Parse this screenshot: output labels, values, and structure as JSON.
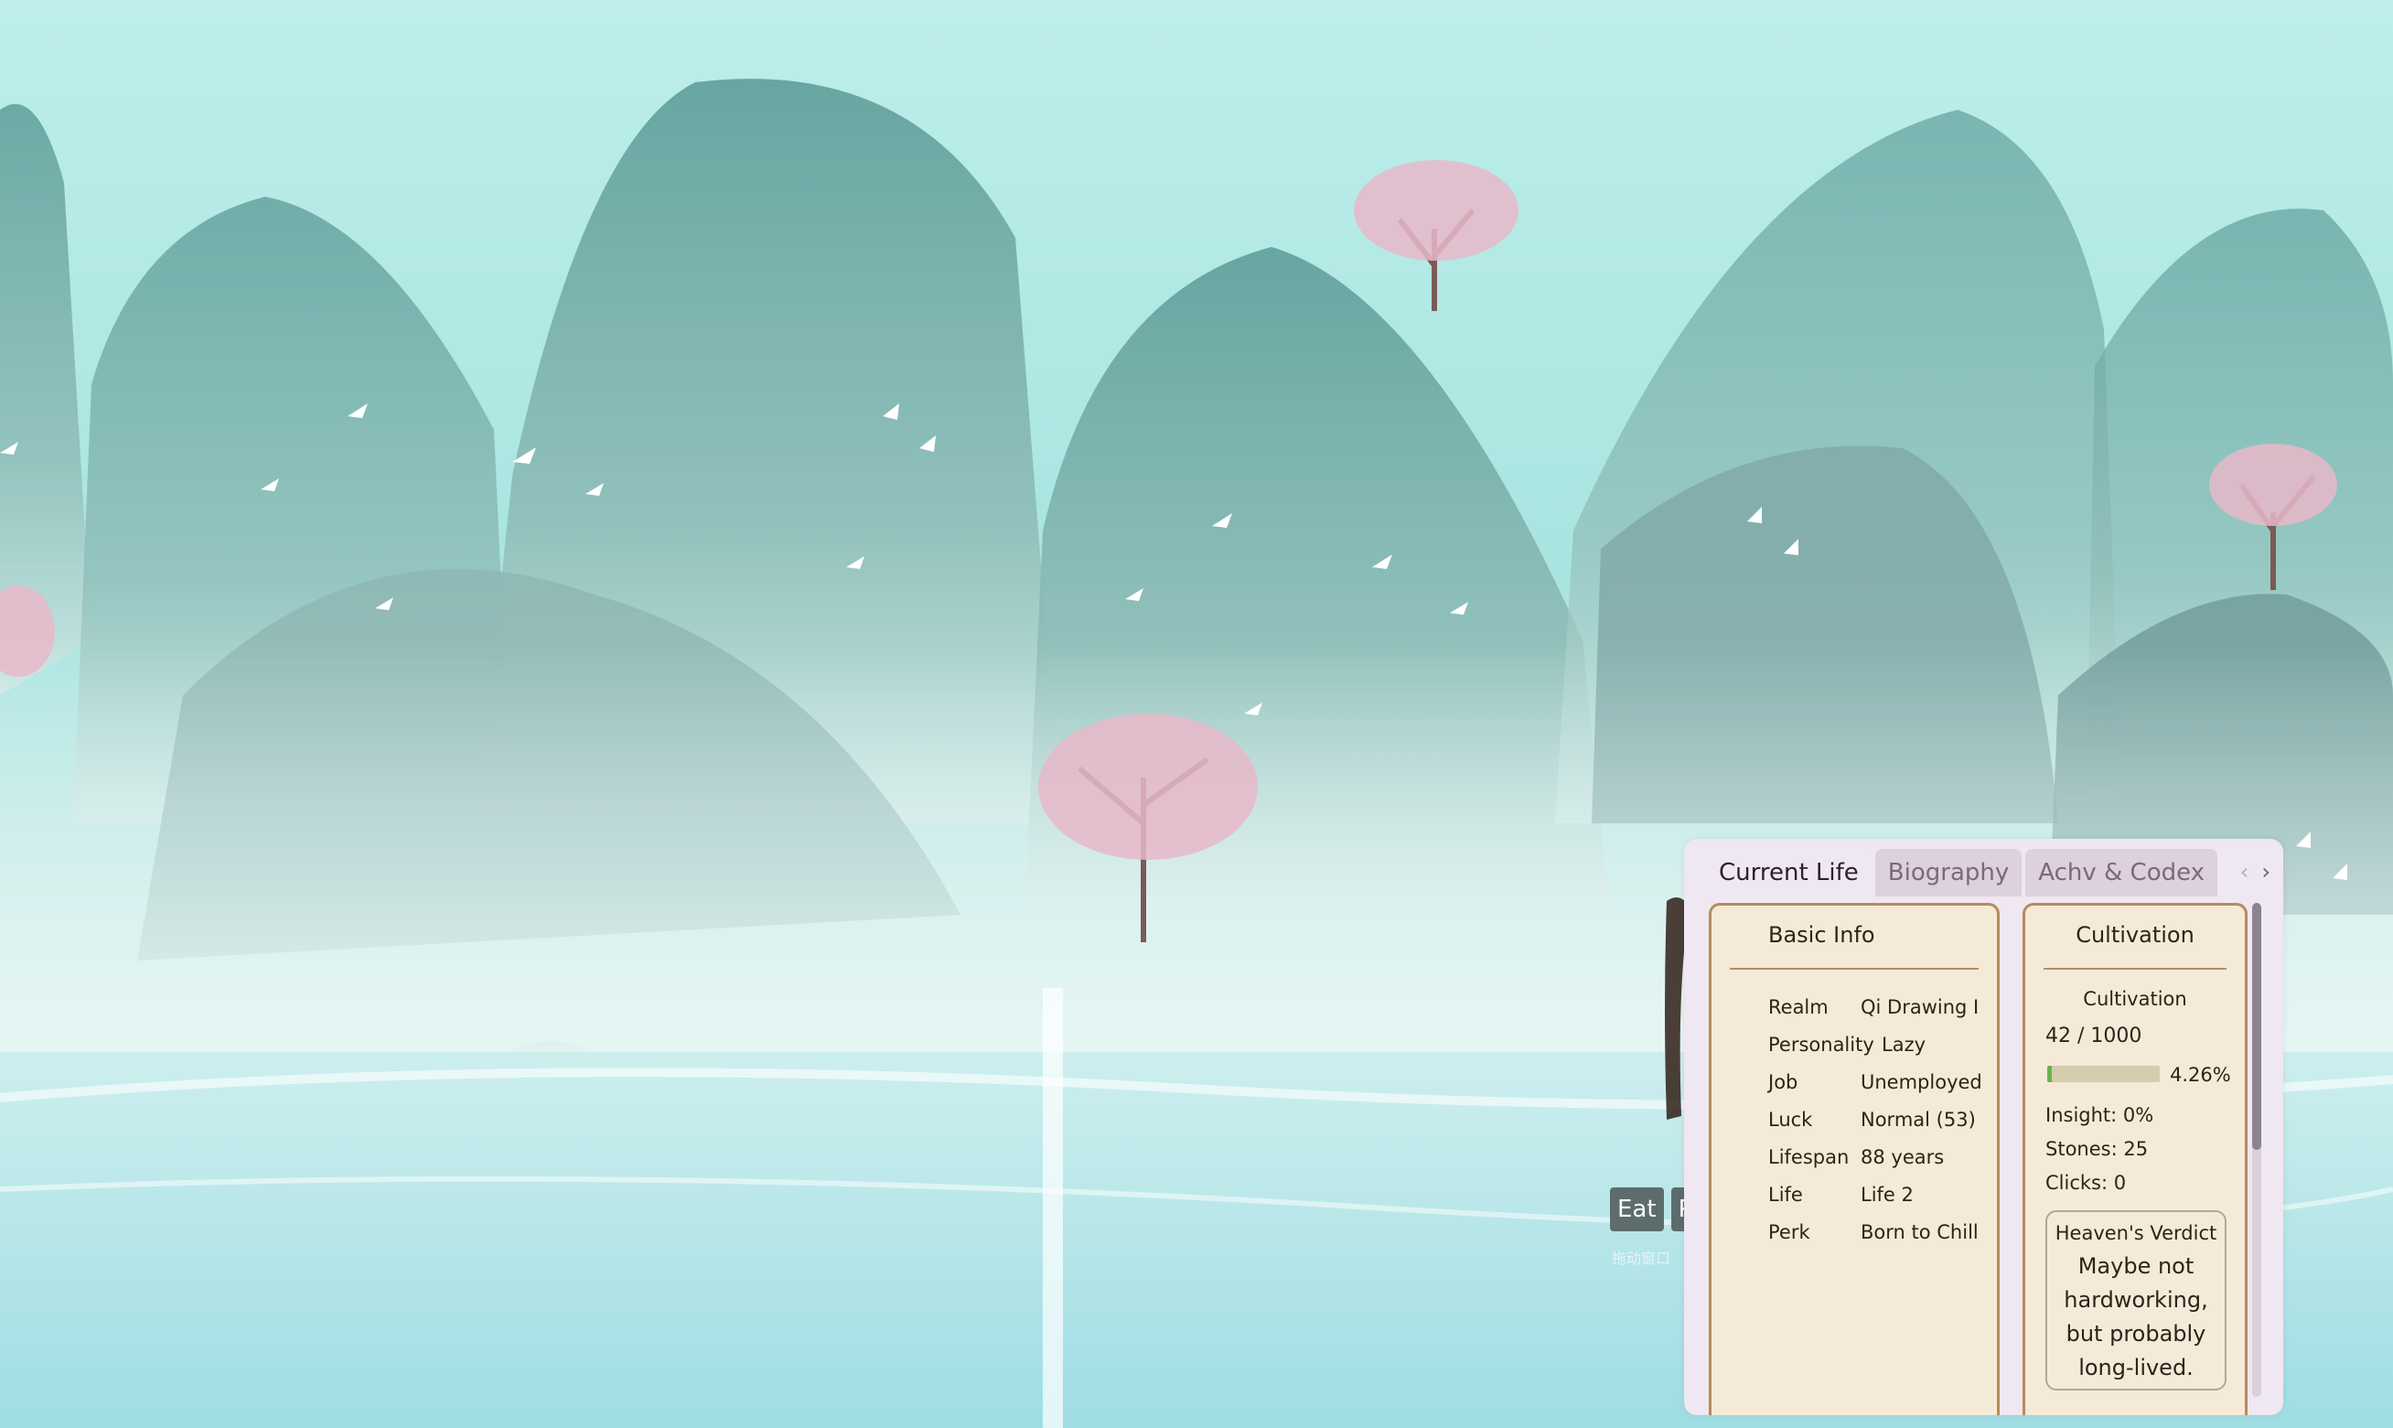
{
  "tabs": [
    {
      "label": "Current Life",
      "active": true
    },
    {
      "label": "Biography",
      "active": false
    },
    {
      "label": "Achv & Codex",
      "active": false
    }
  ],
  "nav": {
    "prev": "‹",
    "next": "›"
  },
  "actions": [
    {
      "label": "Eat"
    },
    {
      "label": "P"
    }
  ],
  "hint": "拖动窗口",
  "basic_info": {
    "title": "Basic Info",
    "rows": [
      {
        "key": "Realm",
        "value": "Qi Drawing I"
      },
      {
        "key": "Personality",
        "value": "Lazy"
      },
      {
        "key": "Job",
        "value": "Unemployed"
      },
      {
        "key": "Luck",
        "value": "Normal (53)"
      },
      {
        "key": "Lifespan",
        "value": "88 years"
      },
      {
        "key": "Life",
        "value": "Life 2"
      },
      {
        "key": "Perk",
        "value": "Born to Chill"
      }
    ]
  },
  "cultivation": {
    "title": "Cultivation",
    "label": "Cultivation",
    "progress_text": "42 / 1000",
    "progress_fraction": 0.042,
    "percent": "4.26%",
    "insight": "Insight: 0%",
    "stones": "Stones: 25",
    "clicks": "Clicks: 0",
    "verdict_title": "Heaven's Verdict",
    "verdict_text": "Maybe not hardworking, but probably long-lived."
  },
  "colors": {
    "sky": "#bdeeea",
    "mountain": "#6fa9a4",
    "panel_bg": "#efe7f1",
    "card_bg": "#f5ead8",
    "card_border": "#b58c59",
    "progress_fill": "#69b24a"
  }
}
